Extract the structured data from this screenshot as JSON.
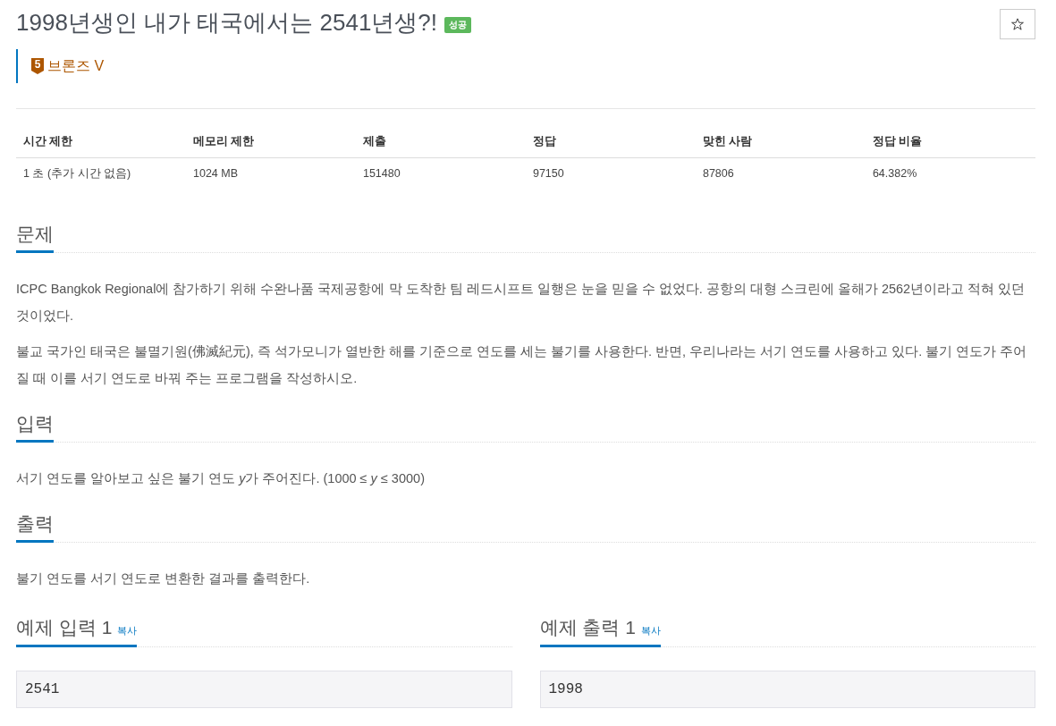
{
  "problem": {
    "title": "1998년생인 내가 태국에서는 2541년생?!",
    "status_label": "성공",
    "tier": {
      "number": "5",
      "label": "브론즈 V"
    }
  },
  "info_table": {
    "columns": [
      "시간 제한",
      "메모리 제한",
      "제출",
      "정답",
      "맞힌 사람",
      "정답 비율"
    ],
    "rows": [
      [
        "1 초 (추가 시간 없음)",
        "1024 MB",
        "151480",
        "97150",
        "87806",
        "64.382%"
      ]
    ]
  },
  "sections": [
    {
      "heading": "문제",
      "paragraphs": [
        [
          {
            "text": "ICPC Bangkok Regional에 참가하기 위해 수완나품 국제공항에 막 도착한 팀 레드시프트 일행은 눈을 믿을 수 없었다. 공항의 대형 스크린에 올해가 2562년이라고 적혀 있던 것이었다.",
            "italic": false
          }
        ],
        [
          {
            "text": "불교 국가인 태국은 불멸기원(佛滅紀元), 즉 석가모니가 열반한 해를 기준으로 연도를 세는 불기를 사용한다. 반면, 우리나라는 서기 연도를 사용하고 있다. 불기 연도가 주어질 때 이를 서기 연도로 바꿔 주는 프로그램을 작성하시오.",
            "italic": false
          }
        ]
      ]
    },
    {
      "heading": "입력",
      "paragraphs": [
        [
          {
            "text": "서기 연도를 알아보고 싶은 불기 연도 ",
            "italic": false
          },
          {
            "text": "y",
            "italic": true
          },
          {
            "text": "가 주어진다. (1000 ≤ ",
            "italic": false
          },
          {
            "text": "y",
            "italic": true
          },
          {
            "text": " ≤ 3000)",
            "italic": false
          }
        ]
      ]
    },
    {
      "heading": "출력",
      "paragraphs": [
        [
          {
            "text": "불기 연도를 서기 연도로 변환한 결과를 출력한다.",
            "italic": false
          }
        ]
      ]
    }
  ],
  "samples": [
    {
      "heading": "예제 입력 1",
      "copy_link": "복사",
      "value": "2541"
    },
    {
      "heading": "예제 출력 1",
      "copy_link": "복사",
      "value": "1998"
    }
  ]
}
